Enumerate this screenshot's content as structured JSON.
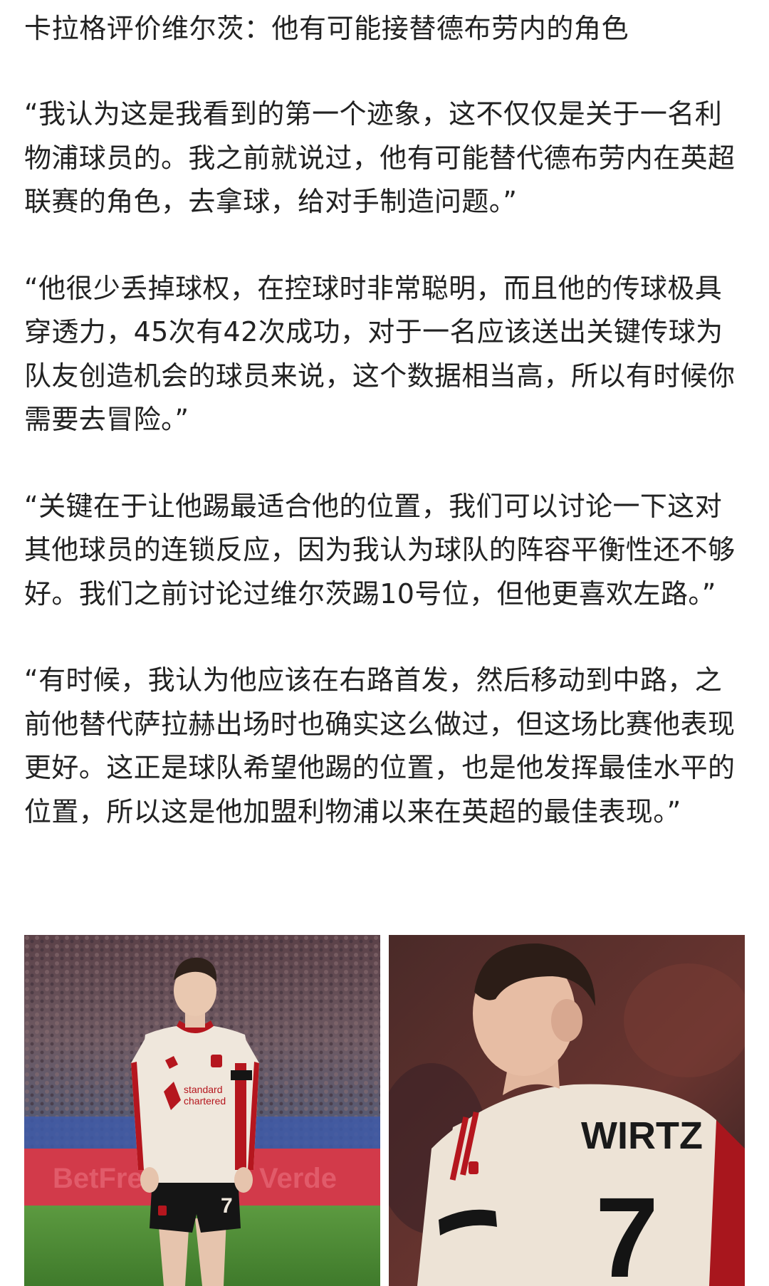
{
  "article": {
    "title": "卡拉格评价维尔茨：他有可能接替德布劳内的角色",
    "paragraphs": [
      "“我认为这是我看到的第一个迹象，这不仅仅是关于一名利物浦球员的。我之前就说过，他有可能替代德布劳内在英超联赛的角色，去拿球，给对手制造问题。”",
      "“他很少丢掉球权，在控球时非常聪明，而且他的传球极具穿透力，45次有42次成功，对于一名应该送出关键传球为队友创造机会的球员来说，这个数据相当高，所以有时候你需要去冒险。”",
      "“关键在于让他踢最适合他的位置，我们可以讨论一下这对其他球员的连锁反应，因为我认为球队的阵容平衡性还不够好。我们之前讨论过维尔茨踢10号位，但他更喜欢左路。”",
      "“有时候，我认为他应该在右路首发，然后移动到中路，之前他替代萨拉赫出场时也确实这么做过，但这场比赛他表现更好。这正是球队希望他踢的位置，也是他发挥最佳水平的位置，所以这是他加盟利物浦以来在英超的最佳表现。”"
    ]
  },
  "photos": {
    "left": {
      "jersey_number": "7",
      "sponsor_line1": "standard",
      "sponsor_line2": "chartered"
    },
    "right": {
      "jersey_name": "WIRTZ",
      "jersey_number": "7"
    }
  },
  "colors": {
    "text": "#222222",
    "background": "#ffffff",
    "kit_cream": "#efe7dc",
    "kit_red": "#b5161e",
    "shorts_black": "#151515",
    "pitch_green": "#4f8a36"
  }
}
